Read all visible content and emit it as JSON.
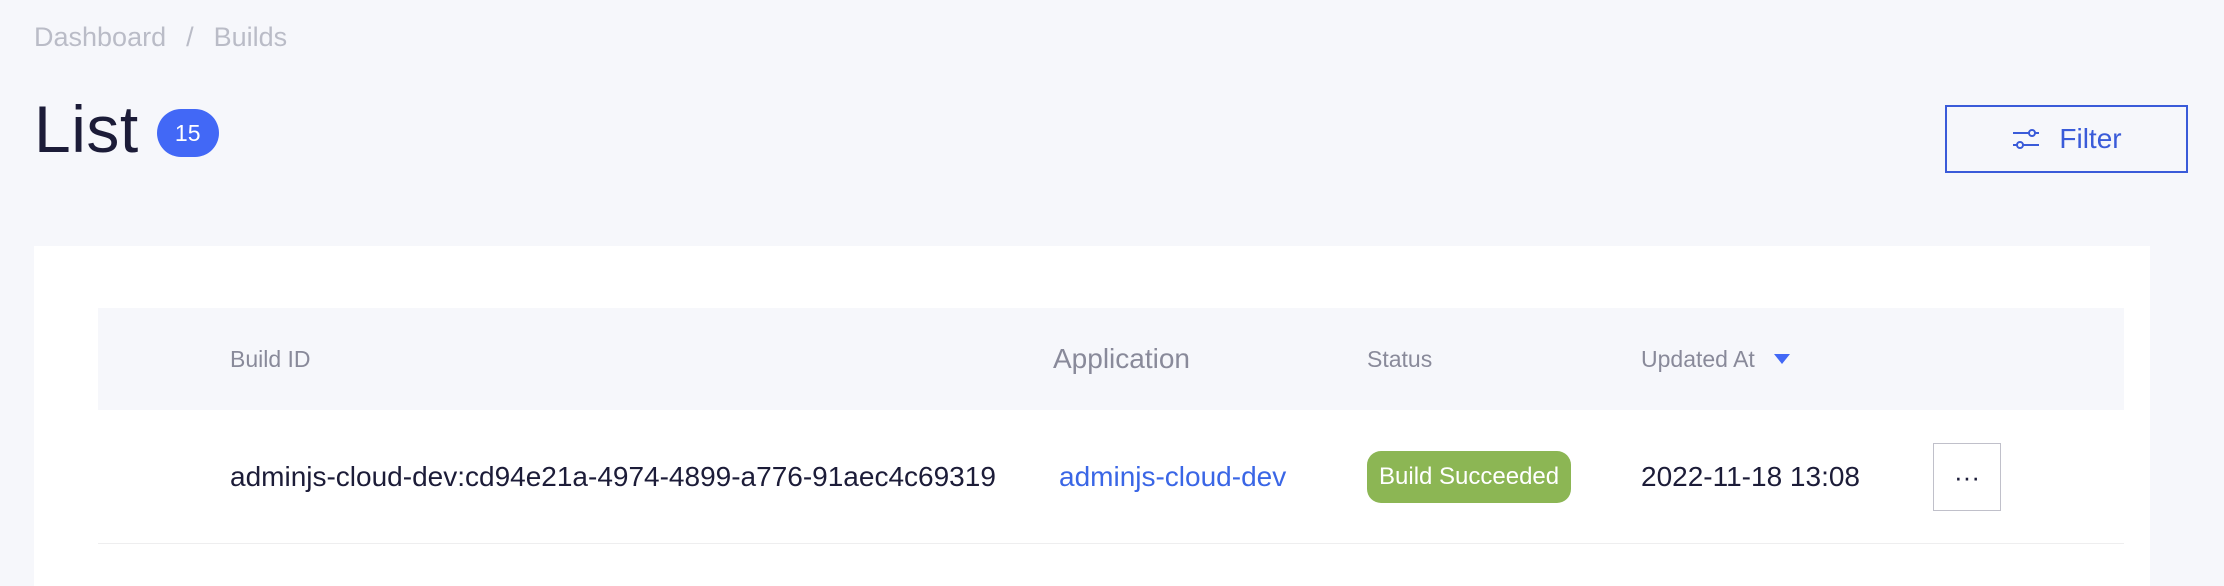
{
  "breadcrumb": {
    "items": [
      "Dashboard",
      "Builds"
    ],
    "separator": "/"
  },
  "header": {
    "title": "List",
    "count": "15",
    "filter_label": "Filter",
    "filter_icon": "sliders-icon"
  },
  "table": {
    "columns": {
      "build_id": "Build ID",
      "application": "Application",
      "status": "Status",
      "updated_at": "Updated At"
    },
    "sort": {
      "column": "updated_at",
      "direction": "desc",
      "icon": "caret-down-icon"
    },
    "rows": [
      {
        "build_id": "adminjs-cloud-dev:cd94e21a-4974-4899-a776-91aec4c69319",
        "application": "adminjs-cloud-dev",
        "status": "Build Succeeded",
        "updated_at": "2022-11-18 13:08",
        "actions_label": "···"
      }
    ]
  },
  "colors": {
    "accent": "#3a5bd9",
    "badge": "#4268f6",
    "success": "#8cb654",
    "background": "#f6f7fb"
  }
}
